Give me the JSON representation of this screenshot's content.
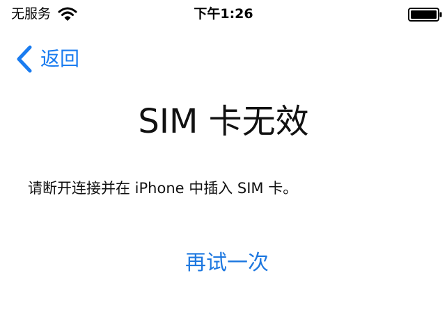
{
  "status_bar": {
    "carrier": "无服务",
    "time": "下午1:26",
    "wifi_icon": "wifi-icon",
    "battery_icon": "battery-icon"
  },
  "nav": {
    "back_label": "返回",
    "back_icon": "chevron-left-icon"
  },
  "main": {
    "title": "SIM 卡无效",
    "message": "请断开连接并在 iPhone 中插入 SIM 卡。",
    "retry_label": "再试一次"
  },
  "colors": {
    "accent": "#1a7cf0",
    "background": "#ffffff",
    "text": "#111111"
  }
}
